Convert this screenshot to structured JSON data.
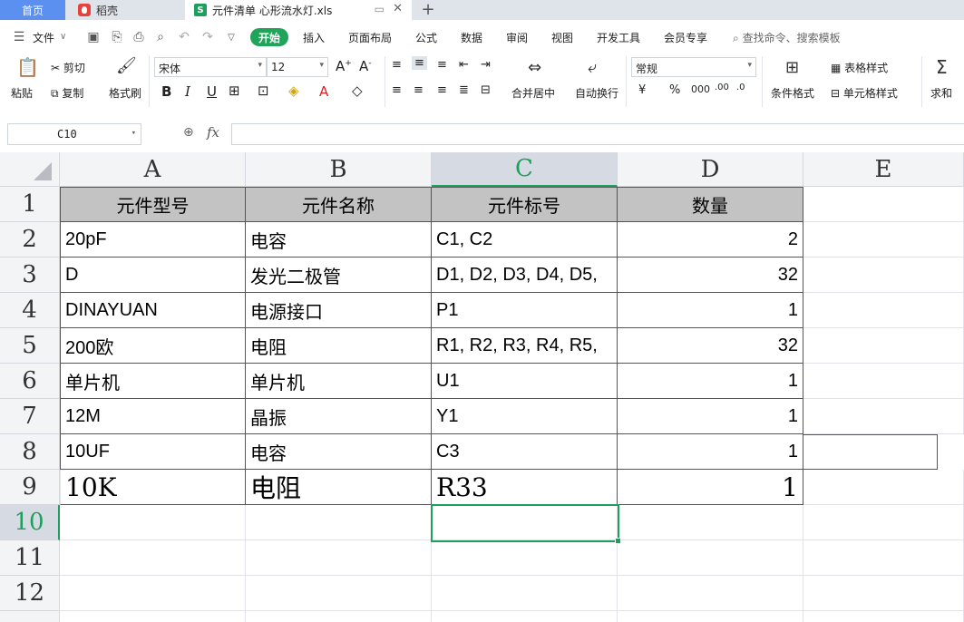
{
  "tabs": {
    "home": "首页",
    "docer": "稻壳",
    "file": "元件清单 心形流水灯.xls",
    "file_icon": "S"
  },
  "menu": {
    "file": "文件",
    "start": "开始",
    "items": [
      "插入",
      "页面布局",
      "公式",
      "数据",
      "审阅",
      "视图",
      "开发工具",
      "会员专享"
    ],
    "search": "查找命令、搜索模板"
  },
  "ribbon": {
    "paste": "粘贴",
    "cut": "剪切",
    "copy": "复制",
    "format_painter": "格式刷",
    "font_name": "宋体",
    "font_size": "12",
    "merge_center": "合并居中",
    "wrap_text": "自动换行",
    "number_format": "常规",
    "conditional_format": "条件格式",
    "table_style": "表格样式",
    "cell_style": "单元格样式",
    "sum": "求和"
  },
  "formula_bar": {
    "name_box": "C10",
    "fx": "fx",
    "formula": ""
  },
  "sheet": {
    "columns": [
      "A",
      "B",
      "C",
      "D",
      "E"
    ],
    "active_column": "C",
    "active_row": "10",
    "rows": [
      "1",
      "2",
      "3",
      "4",
      "5",
      "6",
      "7",
      "8",
      "9",
      "10",
      "11",
      "12"
    ],
    "header": [
      "元件型号",
      "元件名称",
      "元件标号",
      "数量"
    ],
    "data": [
      [
        "20pF",
        "电容",
        "C1, C2",
        "2"
      ],
      [
        "D",
        "发光二极管",
        "D1, D2, D3, D4, D5,",
        "32"
      ],
      [
        "DINAYUAN",
        "电源接口",
        "P1",
        "1"
      ],
      [
        "200欧",
        "电阻",
        "R1, R2, R3, R4, R5,",
        "32"
      ],
      [
        "单片机",
        "单片机",
        "U1",
        "1"
      ],
      [
        "12M",
        "晶振",
        "Y1",
        "1"
      ],
      [
        "10UF",
        "电容",
        "C3",
        "1"
      ],
      [
        "10K",
        "电阻",
        "R33",
        "1"
      ]
    ]
  },
  "colors": {
    "accent_green": "#1e9f5d",
    "home_tab": "#5b8ff0",
    "header_fill": "#c3c3c3"
  }
}
